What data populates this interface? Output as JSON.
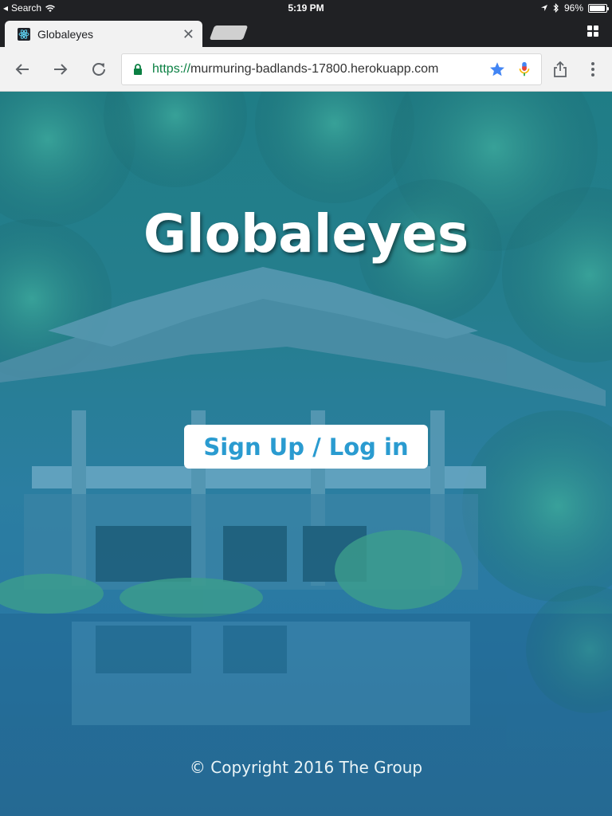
{
  "status_bar": {
    "back_app": "Search",
    "time": "5:19 PM",
    "battery_percent": "96%",
    "battery_level": 0.96
  },
  "tabs": [
    {
      "title": "Globaleyes",
      "active": true
    }
  ],
  "toolbar": {
    "url_scheme": "https://",
    "url_host": "murmuring-badlands-17800.herokuapp.com"
  },
  "hero": {
    "title": "Globaleyes",
    "cta_label": "Sign Up / Log in",
    "footer": "© Copyright 2016 The Group"
  },
  "colors": {
    "accent": "#2a9bd0",
    "secure_green": "#0b8043",
    "bookmark_star": "#4285f4",
    "chrome_dark": "#202124"
  },
  "icons": [
    "back-arrow-icon",
    "forward-arrow-icon",
    "reload-icon",
    "lock-icon",
    "star-icon",
    "microphone-icon",
    "share-icon",
    "more-vert-icon",
    "tab-switcher-icon",
    "react-favicon-icon",
    "wifi-icon",
    "location-icon",
    "bluetooth-icon",
    "battery-icon"
  ]
}
